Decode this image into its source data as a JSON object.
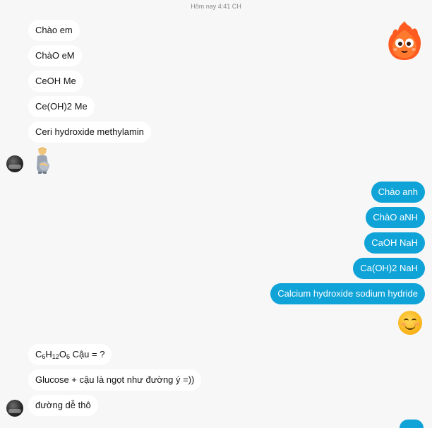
{
  "timestamp": "Hôm nay 4:41 CH",
  "incoming_top": [
    {
      "text": "Chào em"
    },
    {
      "text": "ChàO eM"
    },
    {
      "text": "CeOH Me"
    },
    {
      "text": "Ce(OH)2 Me"
    },
    {
      "text": "Ceri hydroxide methylamin"
    }
  ],
  "outgoing": [
    {
      "text": "Chào anh"
    },
    {
      "text": "ChàO aNH"
    },
    {
      "text": "CaOH NaH"
    },
    {
      "text": "Ca(OH)2 NaH"
    },
    {
      "text": "Calcium hydroxide sodium hydride"
    }
  ],
  "incoming_bottom": {
    "formula": {
      "c": "C",
      "c_n": "6",
      "h": "H",
      "h_n": "12",
      "o": "O",
      "o_n": "6",
      "rest": " Cậu = ?"
    },
    "msg2": "Glucose + cậu là ngọt như đường ý =))",
    "msg3": "đường dễ thô"
  },
  "icons": {
    "sticker": "fire-mascot-sticker",
    "person_emoji": "pregnant-man-emoji",
    "smile_emoji": "smiling-face-emoji",
    "avatar": "user-avatar"
  },
  "colors": {
    "outgoing_bubble": "#0fa3d8",
    "incoming_bubble": "#ffffff",
    "background": "#f7f7f7"
  }
}
